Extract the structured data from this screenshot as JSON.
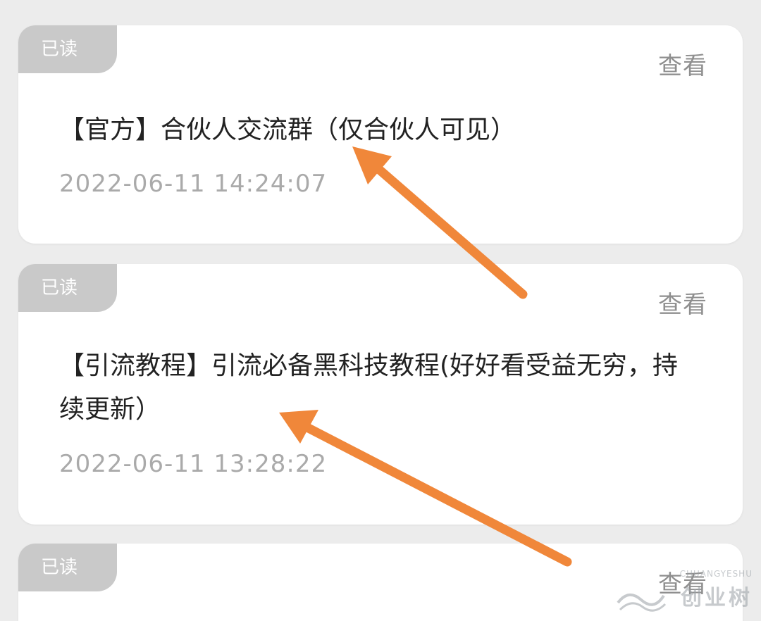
{
  "messages": [
    {
      "badge": "已读",
      "view_label": "查看",
      "title": "【官方】合伙人交流群（仅合伙人可见）",
      "time": "2022-06-11 14:24:07"
    },
    {
      "badge": "已读",
      "view_label": "查看",
      "title": "【引流教程】引流必备黑科技教程(好好看受益无穷，持续更新）",
      "time": "2022-06-11 13:28:22"
    },
    {
      "badge": "已读",
      "view_label": "查看"
    }
  ],
  "watermark": {
    "main": "创业树",
    "sub": "CHUANGYESHU"
  },
  "colors": {
    "arrow": "#f0873a",
    "badge_bg": "#c9c9c9",
    "card_bg": "#ffffff",
    "page_bg": "#ececec"
  }
}
